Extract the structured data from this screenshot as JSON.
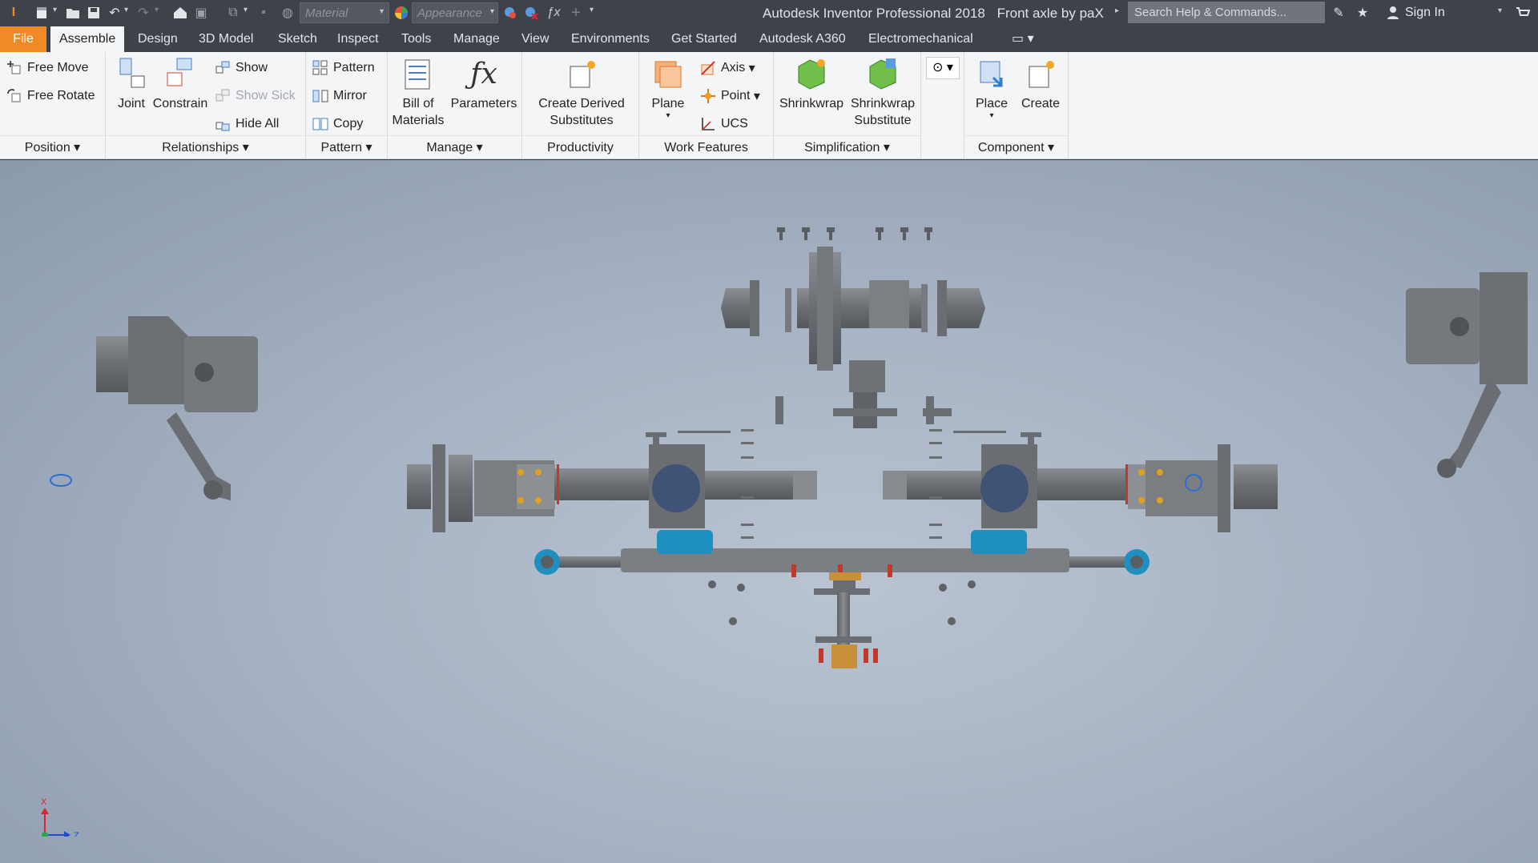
{
  "title_bar": {
    "app_title": "Autodesk Inventor Professional 2018",
    "document_title": "Front axle by paX",
    "material_placeholder": "Material",
    "appearance_placeholder": "Appearance",
    "search_placeholder": "Search Help & Commands...",
    "sign_in": "Sign In"
  },
  "tabs": [
    {
      "label": "File"
    },
    {
      "label": "Assemble"
    },
    {
      "label": "Design"
    },
    {
      "label": "3D Model"
    },
    {
      "label": "Sketch"
    },
    {
      "label": "Inspect"
    },
    {
      "label": "Tools"
    },
    {
      "label": "Manage"
    },
    {
      "label": "View"
    },
    {
      "label": "Environments"
    },
    {
      "label": "Get Started"
    },
    {
      "label": "Autodesk A360"
    },
    {
      "label": "Electromechanical"
    }
  ],
  "ribbon": {
    "position": {
      "footer": "Position",
      "free_move": "Free Move",
      "free_rotate": "Free Rotate"
    },
    "relationships": {
      "footer": "Relationships",
      "joint": "Joint",
      "constrain": "Constrain",
      "show": "Show",
      "show_sick": "Show Sick",
      "hide_all": "Hide All"
    },
    "pattern": {
      "footer": "Pattern",
      "pattern": "Pattern",
      "mirror": "Mirror",
      "copy": "Copy"
    },
    "manage": {
      "footer": "Manage",
      "bom_line1": "Bill of",
      "bom_line2": "Materials",
      "parameters": "Parameters"
    },
    "productivity": {
      "footer": "Productivity",
      "line1": "Create Derived",
      "line2": "Substitutes"
    },
    "work_features": {
      "footer": "Work Features",
      "plane": "Plane",
      "axis": "Axis",
      "point": "Point",
      "ucs": "UCS"
    },
    "simplification": {
      "footer": "Simplification",
      "shrinkwrap": "Shrinkwrap",
      "sws_line1": "Shrinkwrap",
      "sws_line2": "Substitute"
    },
    "component": {
      "footer": "Component",
      "place": "Place",
      "create": "Create"
    }
  },
  "triad": {
    "x": "X",
    "z": "Z"
  },
  "colors": {
    "file_tab": "#f08a24",
    "titlebar": "#3e434a",
    "ribbon": "#f4f5f6",
    "part_gray": "#6b6e72",
    "part_blue": "#1f8fc0"
  }
}
